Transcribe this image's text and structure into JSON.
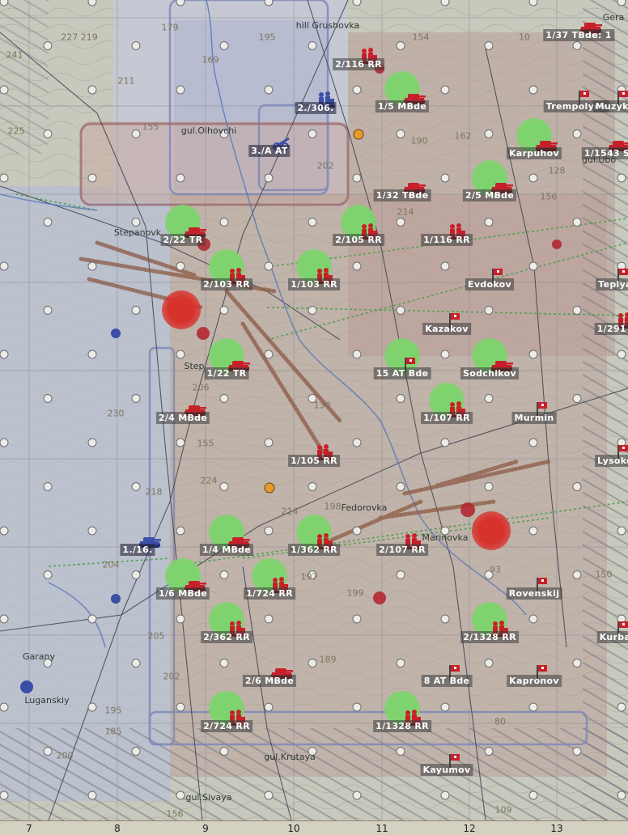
{
  "colors": {
    "soviet": "#c8202a",
    "german": "#3c4fa8",
    "friendly_zone": "#7fd36e",
    "terrain": "#b9a69a"
  },
  "columns": [
    "7",
    "8",
    "9",
    "10",
    "11",
    "12",
    "13"
  ],
  "units": [
    {
      "name": "2/116 RR",
      "side": "soviet",
      "kind": "infantry",
      "highlight": false
    },
    {
      "name": "1/5 MBde",
      "side": "soviet",
      "kind": "tank",
      "highlight": true
    },
    {
      "name": "1/37 TBde: 1",
      "side": "soviet",
      "kind": "tank",
      "highlight": false
    },
    {
      "name": "Trempolyev",
      "side": "soviet",
      "kind": "hq",
      "highlight": false
    },
    {
      "name": "Muzyko",
      "side": "soviet",
      "kind": "hq",
      "highlight": false
    },
    {
      "name": "2./306.",
      "side": "german",
      "kind": "infantry",
      "highlight": false
    },
    {
      "name": "3./A AT",
      "side": "german",
      "kind": "at",
      "highlight": false
    },
    {
      "name": "Karpuhov",
      "side": "soviet",
      "kind": "tank",
      "highlight": true
    },
    {
      "name": "1/1543 S",
      "side": "soviet",
      "kind": "tank",
      "highlight": false
    },
    {
      "name": "1/32 TBde",
      "side": "soviet",
      "kind": "tank",
      "highlight": false
    },
    {
      "name": "2/5 MBde",
      "side": "soviet",
      "kind": "tank",
      "highlight": true
    },
    {
      "name": "2/22 TR",
      "side": "soviet",
      "kind": "tank",
      "highlight": true
    },
    {
      "name": "2/105 RR",
      "side": "soviet",
      "kind": "infantry",
      "highlight": true
    },
    {
      "name": "1/116 RR",
      "side": "soviet",
      "kind": "infantry",
      "highlight": false
    },
    {
      "name": "2/103 RR",
      "side": "soviet",
      "kind": "infantry",
      "highlight": true
    },
    {
      "name": "1/103 RR",
      "side": "soviet",
      "kind": "infantry",
      "highlight": true
    },
    {
      "name": "Evdokov",
      "side": "soviet",
      "kind": "hq",
      "highlight": false
    },
    {
      "name": "Teplya",
      "side": "soviet",
      "kind": "hq",
      "highlight": false
    },
    {
      "name": "Kazakov",
      "side": "soviet",
      "kind": "hq",
      "highlight": false
    },
    {
      "name": "1/291 I",
      "side": "soviet",
      "kind": "infantry",
      "highlight": false
    },
    {
      "name": "1/22 TR",
      "side": "soviet",
      "kind": "tank",
      "highlight": true
    },
    {
      "name": "15 AT Bde",
      "side": "soviet",
      "kind": "hq",
      "highlight": true
    },
    {
      "name": "Sodchikov",
      "side": "soviet",
      "kind": "tank",
      "highlight": true
    },
    {
      "name": "2/4 MBde",
      "side": "soviet",
      "kind": "tank",
      "highlight": false
    },
    {
      "name": "1/107 RR",
      "side": "soviet",
      "kind": "infantry",
      "highlight": true
    },
    {
      "name": "Murmin",
      "side": "soviet",
      "kind": "hq",
      "highlight": false
    },
    {
      "name": "1/105 RR",
      "side": "soviet",
      "kind": "infantry",
      "highlight": false
    },
    {
      "name": "Lysoko",
      "side": "soviet",
      "kind": "hq",
      "highlight": false
    },
    {
      "name": "1./16.",
      "side": "german",
      "kind": "tank",
      "highlight": false
    },
    {
      "name": "1/4 MBde",
      "side": "soviet",
      "kind": "tank",
      "highlight": true
    },
    {
      "name": "1/362 RR",
      "side": "soviet",
      "kind": "infantry",
      "highlight": true
    },
    {
      "name": "2/107 RR",
      "side": "soviet",
      "kind": "infantry",
      "highlight": false
    },
    {
      "name": "1/6 MBde",
      "side": "soviet",
      "kind": "tank",
      "highlight": true
    },
    {
      "name": "1/724 RR",
      "side": "soviet",
      "kind": "infantry",
      "highlight": true
    },
    {
      "name": "Rovenskij",
      "side": "soviet",
      "kind": "hq",
      "highlight": false
    },
    {
      "name": "2/362 RR",
      "side": "soviet",
      "kind": "infantry",
      "highlight": true
    },
    {
      "name": "2/1328 RR",
      "side": "soviet",
      "kind": "infantry",
      "highlight": true
    },
    {
      "name": "Kurba",
      "side": "soviet",
      "kind": "hq",
      "highlight": false
    },
    {
      "name": "2/6 MBde",
      "side": "soviet",
      "kind": "tank",
      "highlight": false
    },
    {
      "name": "8 AT Bde",
      "side": "soviet",
      "kind": "hq",
      "highlight": false
    },
    {
      "name": "Kapronov",
      "side": "soviet",
      "kind": "hq",
      "highlight": false
    },
    {
      "name": "2/724 RR",
      "side": "soviet",
      "kind": "infantry",
      "highlight": true
    },
    {
      "name": "1/1328 RR",
      "side": "soviet",
      "kind": "infantry",
      "highlight": true
    },
    {
      "name": "Kayumov",
      "side": "soviet",
      "kind": "hq",
      "highlight": false
    }
  ],
  "towns": [
    "hill Grushovka",
    "gul.Olhovchi",
    "Stepanovk",
    "Step",
    "Fedorovka",
    "Marinovka",
    "Garany",
    "Luganskiy",
    "gul.Krutaya",
    "gul.Sivaya",
    "gul.Ubo",
    "Gera"
  ],
  "elevations": [
    "241",
    "227 219",
    "225",
    "195",
    "211",
    "169",
    "155",
    "179",
    "190",
    "202",
    "214",
    "130",
    "206",
    "230",
    "218",
    "224",
    "214",
    "198",
    "155",
    "204",
    "199",
    "197",
    "189",
    "205",
    "202",
    "195",
    "185",
    "200",
    "156",
    "93",
    "80",
    "109",
    "150",
    "128",
    "156",
    "162",
    "154",
    "10"
  ]
}
